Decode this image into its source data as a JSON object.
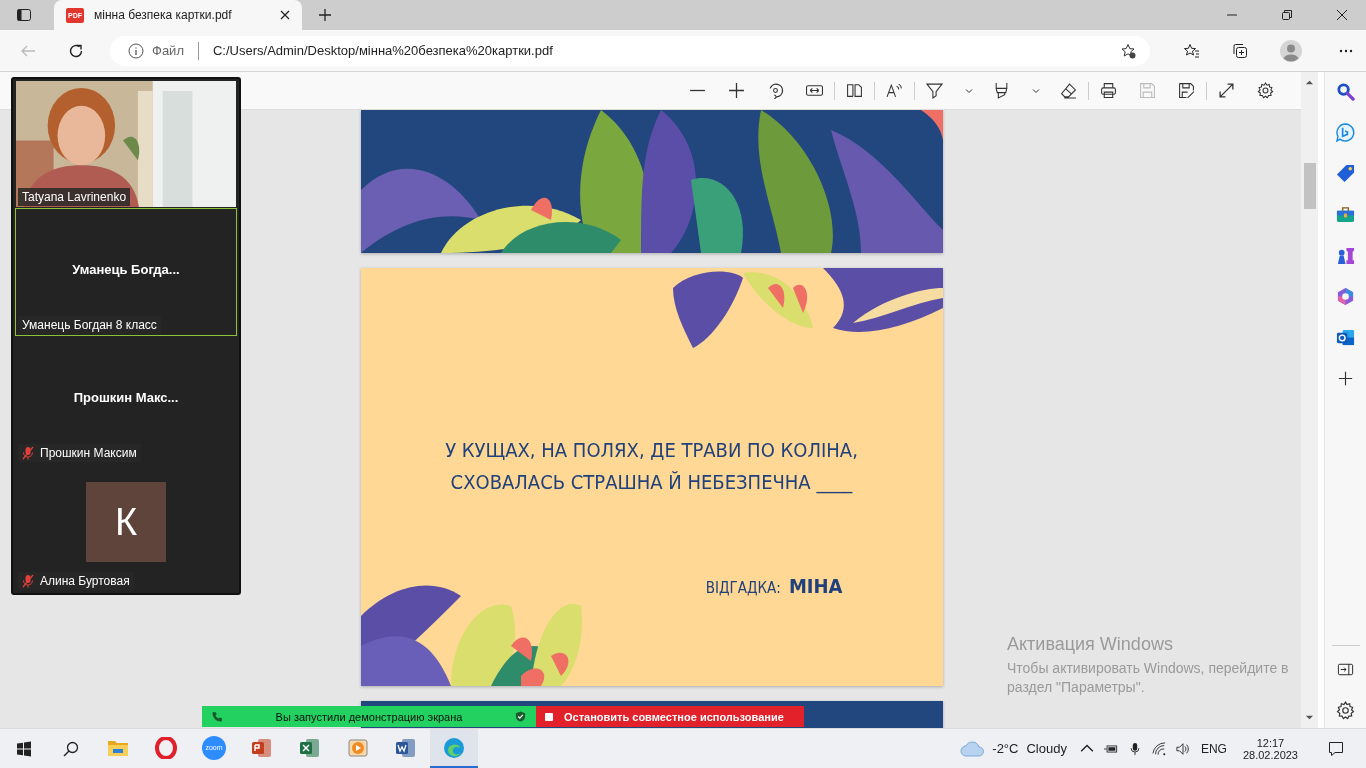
{
  "browser": {
    "tab_icon_label": "PDF",
    "tab_title": "мінна безпека картки.pdf",
    "back_disabled": true,
    "address_label": "Файл",
    "url": "C:/Users/Admin/Desktop/мінна%20безпека%20картки.pdf"
  },
  "pdf_toolbar": {
    "save_disabled": true
  },
  "card": {
    "question_lines": [
      "У КУЩАХ, НА ПОЛЯХ, ДЕ ТРАВИ ПО КОЛІНА,",
      "СХОВАЛАСЬ СТРАШНА Й НЕБЕЗПЕЧНА ____"
    ],
    "answer_label": "ВІДГАДКА:",
    "answer": "МІНА"
  },
  "participants": [
    {
      "kind": "video",
      "name": "Tatyana Lavrinenko",
      "muted": false,
      "active": false
    },
    {
      "kind": "name",
      "display": "Уманець  Богда...",
      "name": "Уманець Богдан 8 класс",
      "muted": false,
      "active": true
    },
    {
      "kind": "name",
      "display": "Прошкин  Макс...",
      "name": "Прошкин Максим",
      "muted": true,
      "active": false
    },
    {
      "kind": "avatar",
      "initial": "К",
      "name": "Алина Буртовая",
      "muted": true,
      "active": false
    }
  ],
  "share_bar": {
    "status": "Вы запустили демонстрацию экрана",
    "stop": "Остановить совместное использование"
  },
  "activation": {
    "title": "Активация Windows",
    "text": "Чтобы активировать Windows, перейдите в раздел \"Параметры\"."
  },
  "taskbar": {
    "apps": [
      {
        "kind": "explorer",
        "selected": false
      },
      {
        "kind": "opera",
        "selected": false
      },
      {
        "kind": "zoom",
        "label": "zoom",
        "selected": false
      },
      {
        "kind": "powerpoint",
        "selected": false
      },
      {
        "kind": "excel",
        "selected": false
      },
      {
        "kind": "video",
        "selected": false
      },
      {
        "kind": "word",
        "selected": false
      },
      {
        "kind": "edge",
        "selected": true
      }
    ],
    "temperature": "-2°C",
    "weather": "Cloudy",
    "language": "ENG",
    "time": "12:17",
    "date": "28.02.2023"
  }
}
